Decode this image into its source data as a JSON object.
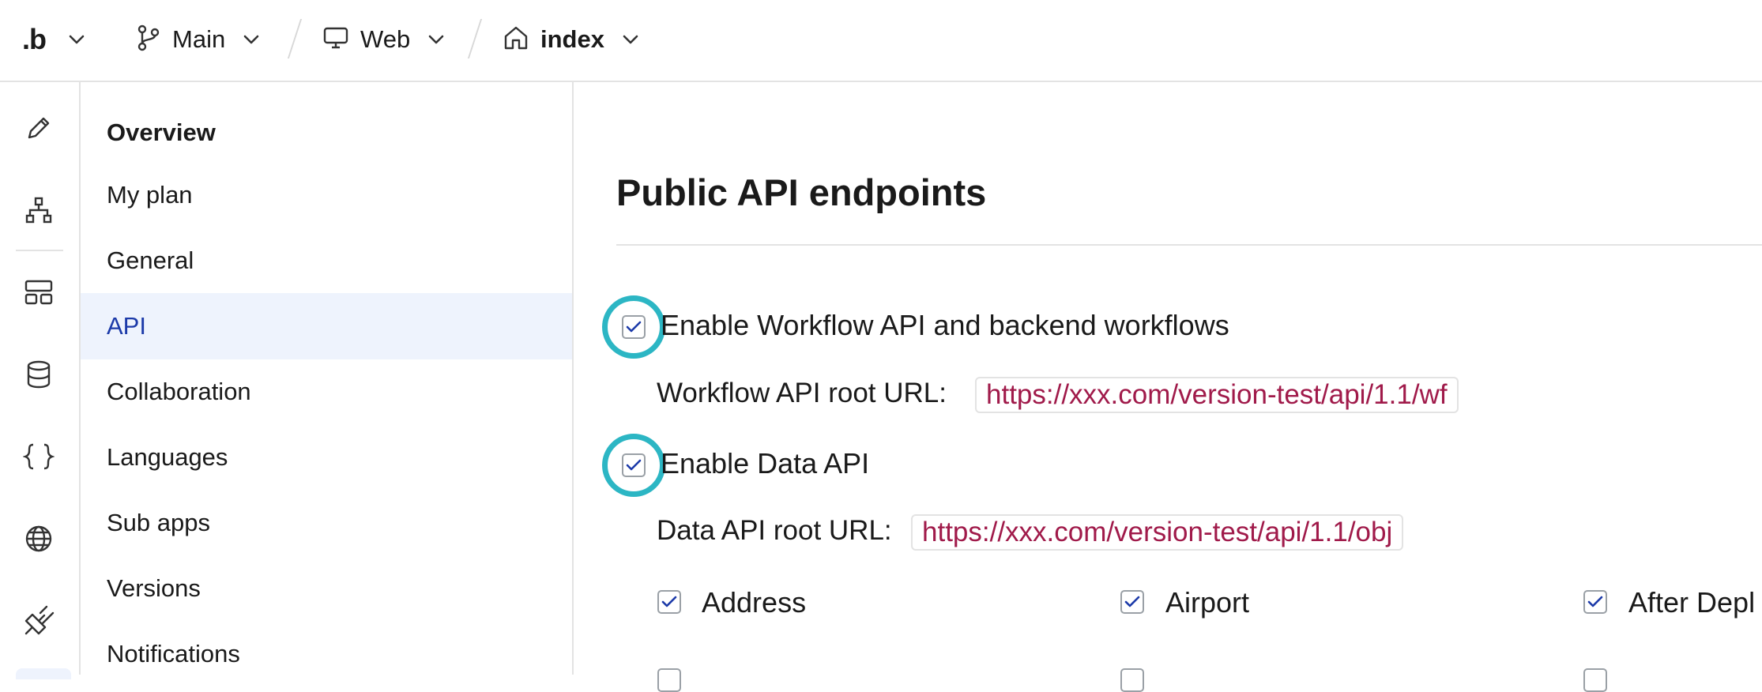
{
  "topbar": {
    "brand": ".b",
    "branch": "Main",
    "platform": "Web",
    "page": "index"
  },
  "rail": {
    "icons": [
      "pencil-icon",
      "sitemap-icon",
      "layout-icon",
      "database-icon",
      "braces-icon",
      "globe-icon",
      "plug-icon"
    ]
  },
  "subnav": {
    "items": [
      {
        "label": "Overview"
      },
      {
        "label": "My plan"
      },
      {
        "label": "General"
      },
      {
        "label": "API"
      },
      {
        "label": "Collaboration"
      },
      {
        "label": "Languages"
      },
      {
        "label": "Sub apps"
      },
      {
        "label": "Versions"
      },
      {
        "label": "Notifications"
      }
    ],
    "active": "API"
  },
  "main": {
    "title": "Public API endpoints",
    "workflow": {
      "checked": true,
      "label": "Enable Workflow API and backend workflows",
      "url_label": "Workflow API root URL:",
      "url": "https://xxx.com/version-test/api/1.1/wf"
    },
    "data_api": {
      "checked": true,
      "label": "Enable Data API",
      "url_label": "Data API root URL:",
      "url": "https://xxx.com/version-test/api/1.1/obj"
    },
    "types": [
      {
        "label": "Address",
        "checked": true
      },
      {
        "label": "Airport",
        "checked": true
      },
      {
        "label": "After Depl",
        "checked": true
      }
    ]
  },
  "colors": {
    "accent": "#1c3aa9",
    "highlight_ring": "#2cb6c4",
    "url_text": "#a01a4a",
    "active_bg": "#eef3fd"
  }
}
